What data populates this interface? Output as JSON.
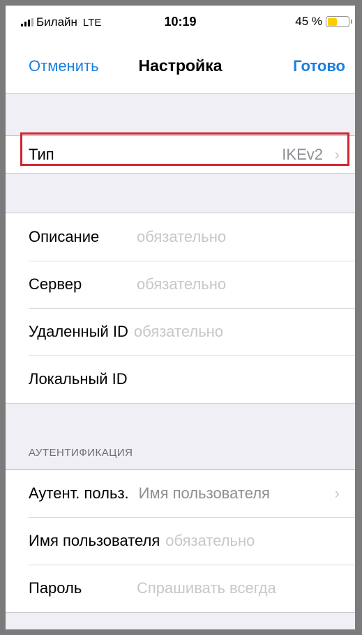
{
  "status_bar": {
    "carrier": "Билайн",
    "network": "LTE",
    "time": "10:19",
    "battery": "45 %",
    "battery_level": 0.45
  },
  "nav": {
    "cancel": "Отменить",
    "title": "Настройка",
    "done": "Готово"
  },
  "type_row": {
    "label": "Тип",
    "value": "IKEv2"
  },
  "fields": [
    {
      "label": "Описание",
      "value": "обязательно"
    },
    {
      "label": "Сервер",
      "value": "обязательно"
    },
    {
      "label": "Удаленный ID",
      "value": "обязательно"
    },
    {
      "label": "Локальный ID",
      "value": ""
    }
  ],
  "auth": {
    "header": "АУТЕНТИФИКАЦИЯ",
    "rows": [
      {
        "label": "Аутент. польз.",
        "value": "Имя пользователя"
      },
      {
        "label": "Имя пользователя",
        "value": "обязательно"
      },
      {
        "label": "Пароль",
        "value": "Спрашивать всегда"
      }
    ]
  },
  "colors": {
    "accent": "#1a7fe0",
    "highlight": "#d0242e",
    "background": "#f0eff5"
  }
}
